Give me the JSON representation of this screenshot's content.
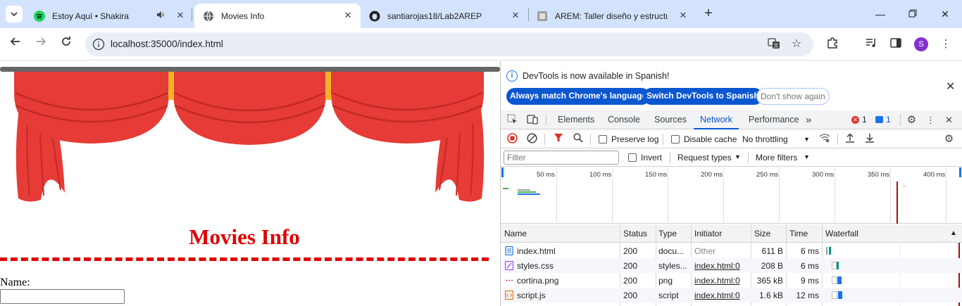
{
  "browser": {
    "tabs": [
      {
        "title": "Estoy Aquí • Shakira",
        "favicon": "spotify-icon",
        "audio": true,
        "active": false
      },
      {
        "title": "Movies Info",
        "favicon": "globe-icon",
        "active": true
      },
      {
        "title": "santiarojas18/Lab2AREP",
        "favicon": "github-icon",
        "active": false
      },
      {
        "title": "AREM: Taller diseño y estructura",
        "favicon": "document-icon",
        "active": false
      }
    ],
    "url": "localhost:35000/index.html"
  },
  "page": {
    "heading": "Movies Info",
    "name_label": "Name:",
    "name_value": "",
    "colors": {
      "heading": "#e00000",
      "curtain": "#e63b36",
      "rod": "#666666"
    }
  },
  "devtools": {
    "infobar": {
      "message": "DevTools is now available in Spanish!",
      "btn_match": "Always match Chrome's language",
      "btn_switch": "Switch DevTools to Spanish",
      "btn_dismiss": "Don't show again"
    },
    "tabs": [
      "Elements",
      "Console",
      "Sources",
      "Network",
      "Performance"
    ],
    "selected_tab": "Network",
    "more_tabs": "»",
    "error_count": "1",
    "message_count": "1",
    "network_toolbar": {
      "preserve_log": "Preserve log",
      "disable_cache": "Disable cache",
      "throttling": "No throttling"
    },
    "filter_bar": {
      "placeholder": "Filter",
      "invert": "Invert",
      "request_types": "Request types",
      "more_filters": "More filters"
    },
    "timeline_ticks": [
      "50 ms",
      "100 ms",
      "150 ms",
      "200 ms",
      "250 ms",
      "300 ms",
      "350 ms",
      "400 ms"
    ],
    "columns": [
      "Name",
      "Status",
      "Type",
      "Initiator",
      "Size",
      "Time",
      "Waterfall"
    ],
    "requests": [
      {
        "name": "index.html",
        "status": "200",
        "type": "docu...",
        "initiator": "Other",
        "size": "611 B",
        "time": "6 ms",
        "icon": "document-icon"
      },
      {
        "name": "styles.css",
        "status": "200",
        "type": "styles...",
        "initiator": "index.html:0",
        "size": "208 B",
        "time": "6 ms",
        "icon": "stylesheet-icon"
      },
      {
        "name": "cortina.png",
        "status": "200",
        "type": "png",
        "initiator": "index.html:0",
        "size": "365 kB",
        "time": "9 ms",
        "icon": "image-icon"
      },
      {
        "name": "script.js",
        "status": "200",
        "type": "script",
        "initiator": "index.html:0",
        "size": "1.6 kB",
        "time": "12 ms",
        "icon": "script-icon"
      }
    ]
  }
}
